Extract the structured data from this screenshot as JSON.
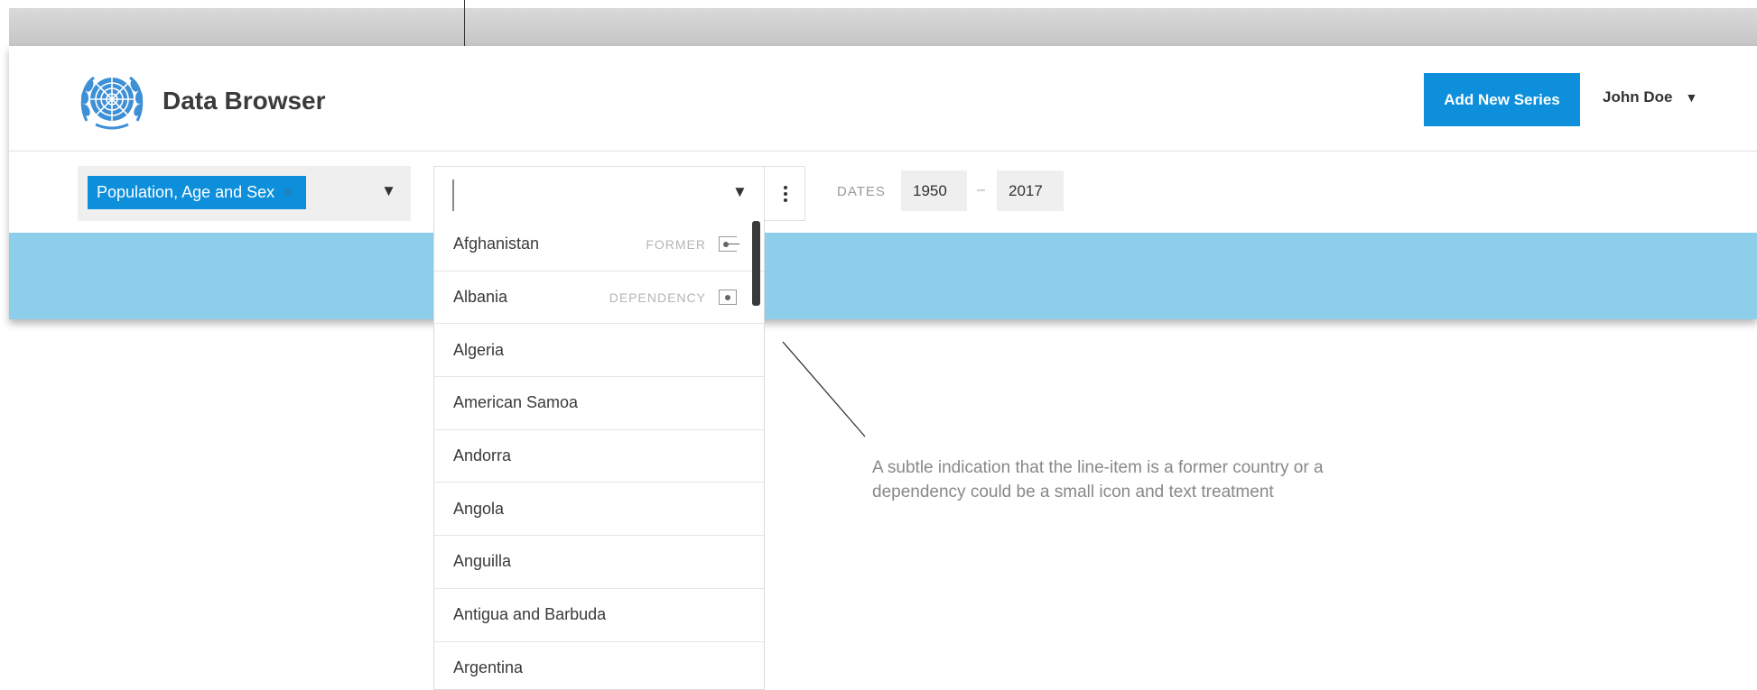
{
  "header": {
    "app_title": "Data Browser",
    "add_button_label": "Add New Series",
    "user_name": "John Doe"
  },
  "filters": {
    "topic_chip_label": "Population, Age and Sex",
    "topic_chip_remove": "×",
    "dates_label": "DATES",
    "date_from": "1950",
    "date_separator": "–",
    "date_to": "2017"
  },
  "dropdown": {
    "options": [
      {
        "label": "Afghanistan",
        "tag": "FORMER",
        "tag_icon": "former-icon"
      },
      {
        "label": "Albania",
        "tag": "DEPENDENCY",
        "tag_icon": "dependency-icon"
      },
      {
        "label": "Algeria"
      },
      {
        "label": "American Samoa"
      },
      {
        "label": "Andorra"
      },
      {
        "label": "Angola"
      },
      {
        "label": "Anguilla"
      },
      {
        "label": "Antigua and Barbuda"
      },
      {
        "label": "Argentina"
      }
    ]
  },
  "annotation": {
    "text": "A subtle indication that the line-item is a former country or a dependency could be a small icon and text treatment"
  },
  "colors": {
    "accent": "#0d8fdc",
    "strip": "#8dcfea",
    "logo": "#3d8fd6"
  }
}
